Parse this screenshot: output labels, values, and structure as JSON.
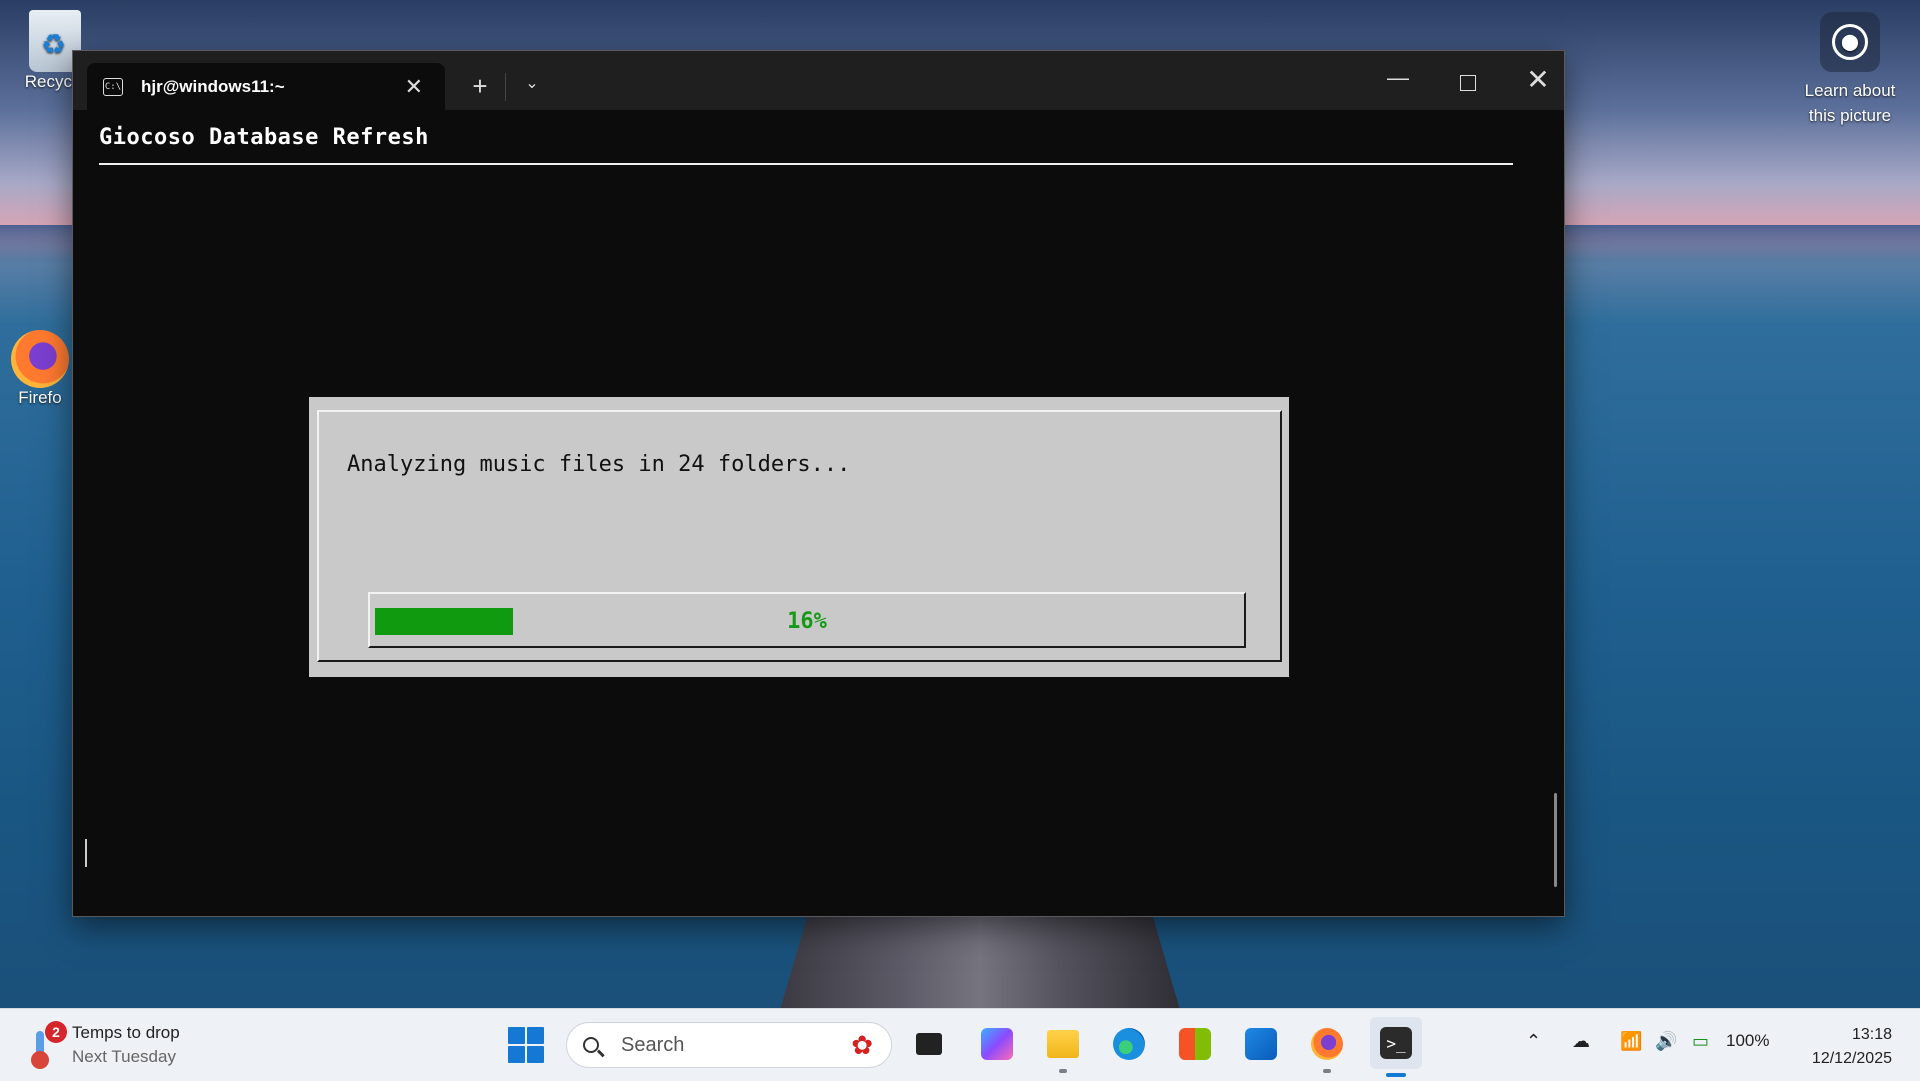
{
  "desktop": {
    "recycle_bin_label": "Recycle",
    "firefox_label": "Firefo",
    "learn_line1": "Learn about",
    "learn_line2": "this picture"
  },
  "window": {
    "tab_title": "hjr@windows11:~",
    "tab_icon_text": "C:\\",
    "new_tab": "+",
    "dropdown": "⌄",
    "minimize": "—",
    "close": "✕",
    "tab_close": "✕"
  },
  "terminal": {
    "app_title": "Giocoso Database Refresh",
    "dialog_message": "Analyzing music files in 24 folders...",
    "progress_percent": 16,
    "progress_label": "16%"
  },
  "taskbar": {
    "weather_badge": "2",
    "weather_title": "Temps to drop",
    "weather_sub": "Next Tuesday",
    "search_placeholder": "Search",
    "apps": [
      "task-view",
      "microsoft-365-copilot",
      "file-explorer",
      "edge",
      "microsoft-store",
      "outlook",
      "firefox",
      "terminal"
    ],
    "battery_percent": "100%",
    "time": "13:18",
    "date": "12/12/2025",
    "accent": "#1478d4"
  }
}
